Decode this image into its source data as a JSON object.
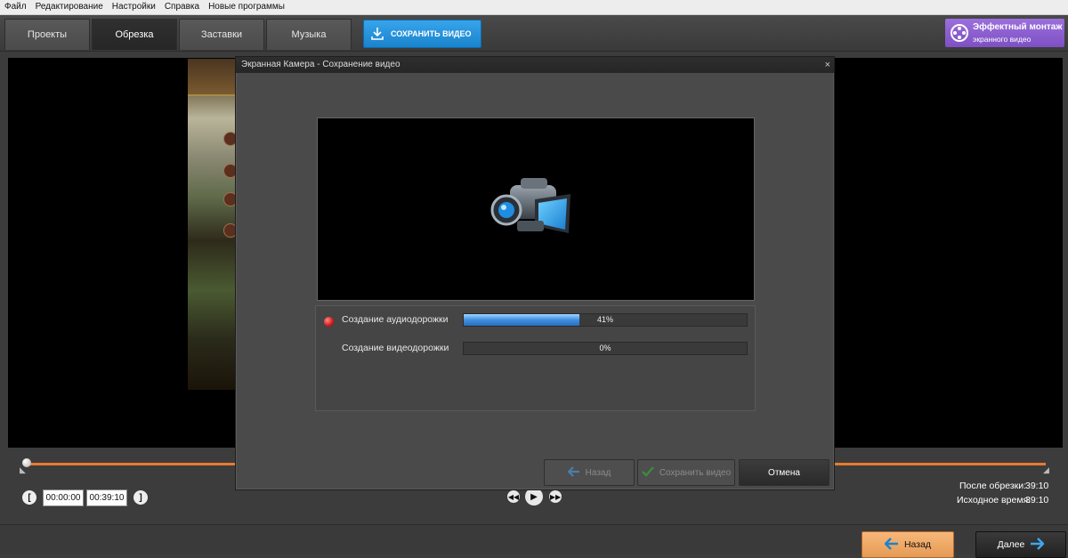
{
  "menu": [
    "Файл",
    "Редактирование",
    "Настройки",
    "Справка",
    "Новые программы"
  ],
  "tabs": [
    "Проекты",
    "Обрезка",
    "Заставки",
    "Музыка"
  ],
  "active_tab": "Обрезка",
  "save_video_button": "СОХРАНИТЬ ВИДЕО",
  "promo": {
    "title": "Эффектный монтаж",
    "subtitle": "экранного видео"
  },
  "dialog": {
    "title": "Экранная Камера - Сохранение видео",
    "close": "×",
    "tasks": [
      {
        "label": "Создание аудиодорожки",
        "progress": 0.41,
        "progress_text": "41%"
      },
      {
        "label": "Создание видеодорожки",
        "progress": 0.0,
        "progress_text": "0%"
      }
    ],
    "buttons": {
      "back": "Назад",
      "save": "Сохранить видео",
      "cancel": "Отмена"
    }
  },
  "timeline": {
    "start_time": "00:00:00",
    "end_time": "00:39:10"
  },
  "stats": {
    "after_trim_label": "После обрезки:",
    "after_trim_value": "39:10",
    "original_label": "Исходное время:",
    "original_value": "39:10"
  },
  "nav": {
    "back": "Назад",
    "next": "Далее"
  },
  "colors": {
    "accent_blue": "#1a83cc",
    "accent_orange": "#e87a30",
    "promo_purple": "#7e50c4"
  }
}
